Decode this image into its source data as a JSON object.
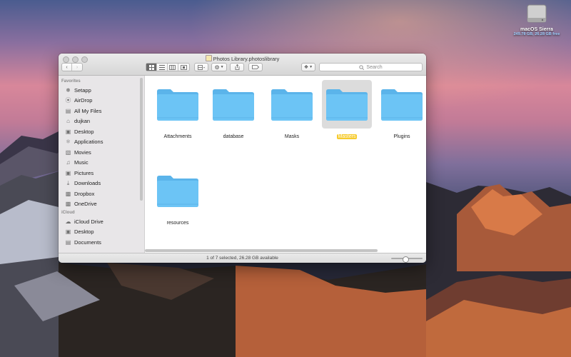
{
  "desktop": {
    "disk": {
      "name": "macOS Sierra",
      "info": "249.78 GB, 26.28 GB free"
    }
  },
  "window": {
    "title": "Photos Library.photoslibrary",
    "search_placeholder": "Search",
    "sidebar": {
      "favorites_header": "Favorites",
      "favorites": [
        {
          "label": "Setapp",
          "icon": "setapp-icon"
        },
        {
          "label": "AirDrop",
          "icon": "airdrop-icon"
        },
        {
          "label": "All My Files",
          "icon": "all-files-icon"
        },
        {
          "label": "dujkan",
          "icon": "home-icon"
        },
        {
          "label": "Desktop",
          "icon": "desktop-icon"
        },
        {
          "label": "Applications",
          "icon": "applications-icon"
        },
        {
          "label": "Movies",
          "icon": "movies-icon"
        },
        {
          "label": "Music",
          "icon": "music-icon"
        },
        {
          "label": "Pictures",
          "icon": "pictures-icon"
        },
        {
          "label": "Downloads",
          "icon": "downloads-icon"
        },
        {
          "label": "Dropbox",
          "icon": "folder-icon"
        },
        {
          "label": "OneDrive",
          "icon": "folder-icon"
        }
      ],
      "icloud_header": "iCloud",
      "icloud": [
        {
          "label": "iCloud Drive",
          "icon": "cloud-icon"
        },
        {
          "label": "Desktop",
          "icon": "desktop-icon"
        },
        {
          "label": "Documents",
          "icon": "documents-icon"
        }
      ]
    },
    "folders": [
      {
        "label": "Attachments",
        "selected": false
      },
      {
        "label": "database",
        "selected": false
      },
      {
        "label": "Masks",
        "selected": false
      },
      {
        "label": "Masters",
        "selected": true
      },
      {
        "label": "Plugins",
        "selected": false
      },
      {
        "label": "resources",
        "selected": false
      }
    ],
    "status": "1 of 7 selected, 26.28 GB available",
    "icon_size_slider": 0.45,
    "colors": {
      "selection_label": "#f6cb2e",
      "folder": "#6cc4f5"
    }
  }
}
